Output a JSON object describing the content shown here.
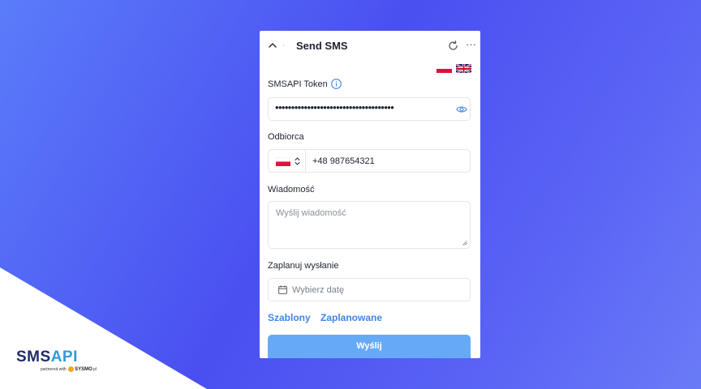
{
  "widget": {
    "title": "Send SMS",
    "tiny_logo_text": "~",
    "more_label": "···",
    "languages": [
      "pl",
      "en"
    ]
  },
  "token": {
    "label": "SMSAPI Token",
    "masked_value": "•••••••••••••••••••••••••••••••••••••"
  },
  "recipient": {
    "label": "Odbiorca",
    "country": "PL",
    "value": "+48 987654321"
  },
  "message": {
    "label": "Wiadomość",
    "placeholder": "Wyślij wiadomość"
  },
  "schedule": {
    "label": "Zaplanuj wysłanie",
    "placeholder": "Wybierz datę"
  },
  "links": {
    "templates": "Szablony",
    "scheduled": "Zaplanowane"
  },
  "send_label": "Wyślij",
  "brand": {
    "name_part1": "SMS",
    "name_part2": "API",
    "partnered": "partnered with",
    "partner_name": "SYSMO",
    "partner_suffix": ".pl"
  },
  "colors": {
    "accent": "#3d86e8",
    "send_button": "#66aaf7",
    "background_start": "#5b7cfa",
    "background_mid": "#4a4ff0"
  }
}
